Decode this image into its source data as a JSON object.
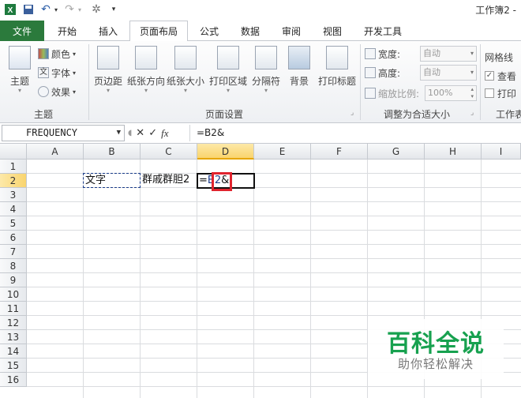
{
  "titlebar": {
    "doc_title": "工作簿2 -",
    "dropdown_glyph": "▾"
  },
  "tabs": {
    "file": "文件",
    "items": [
      "开始",
      "插入",
      "页面布局",
      "公式",
      "数据",
      "审阅",
      "视图",
      "开发工具"
    ],
    "active": "页面布局"
  },
  "ribbon": {
    "theme_group": {
      "label": "主题",
      "theme_btn": "主题",
      "colors": "颜色",
      "fonts": "字体",
      "effects": "效果"
    },
    "page_setup_group": {
      "label": "页面设置",
      "buttons": [
        "页边距",
        "纸张方向",
        "纸张大小",
        "打印区域",
        "分隔符",
        "背景",
        "打印标题"
      ]
    },
    "scale_group": {
      "label": "调整为合适大小",
      "width_label": "宽度:",
      "width_value": "自动",
      "height_label": "高度:",
      "height_value": "自动",
      "scale_label": "缩放比例:",
      "scale_value": "100%"
    },
    "sheet_options_group": {
      "label": "工作表",
      "gridlines": "网格线",
      "view": "查看",
      "print": "打印"
    }
  },
  "formula_bar": {
    "name_box": "FREQUENCY",
    "fx": "fx",
    "cancel": "✕",
    "enter": "✓",
    "formula": "=B2&"
  },
  "grid": {
    "columns": [
      "A",
      "B",
      "C",
      "D",
      "E",
      "F",
      "G",
      "H",
      "I"
    ],
    "selected_column": "D",
    "rows": [
      "1",
      "2",
      "3",
      "4",
      "5",
      "6",
      "7",
      "8",
      "9",
      "10",
      "11",
      "12",
      "13",
      "14",
      "15",
      "16"
    ],
    "selected_row": "2",
    "cells": {
      "B2": "文字",
      "C2": "群戚群胆2",
      "D2_prefix": "=",
      "D2_ref": "B2",
      "D2_suffix": "&"
    }
  },
  "watermark": {
    "title": "百科全说",
    "subtitle": "助你轻松解决"
  },
  "colors": {
    "file_tab": "#2b7a3c",
    "highlight_box": "#e0242e",
    "watermark_green": "#17a14f",
    "selected_header": "#f9d46e"
  }
}
